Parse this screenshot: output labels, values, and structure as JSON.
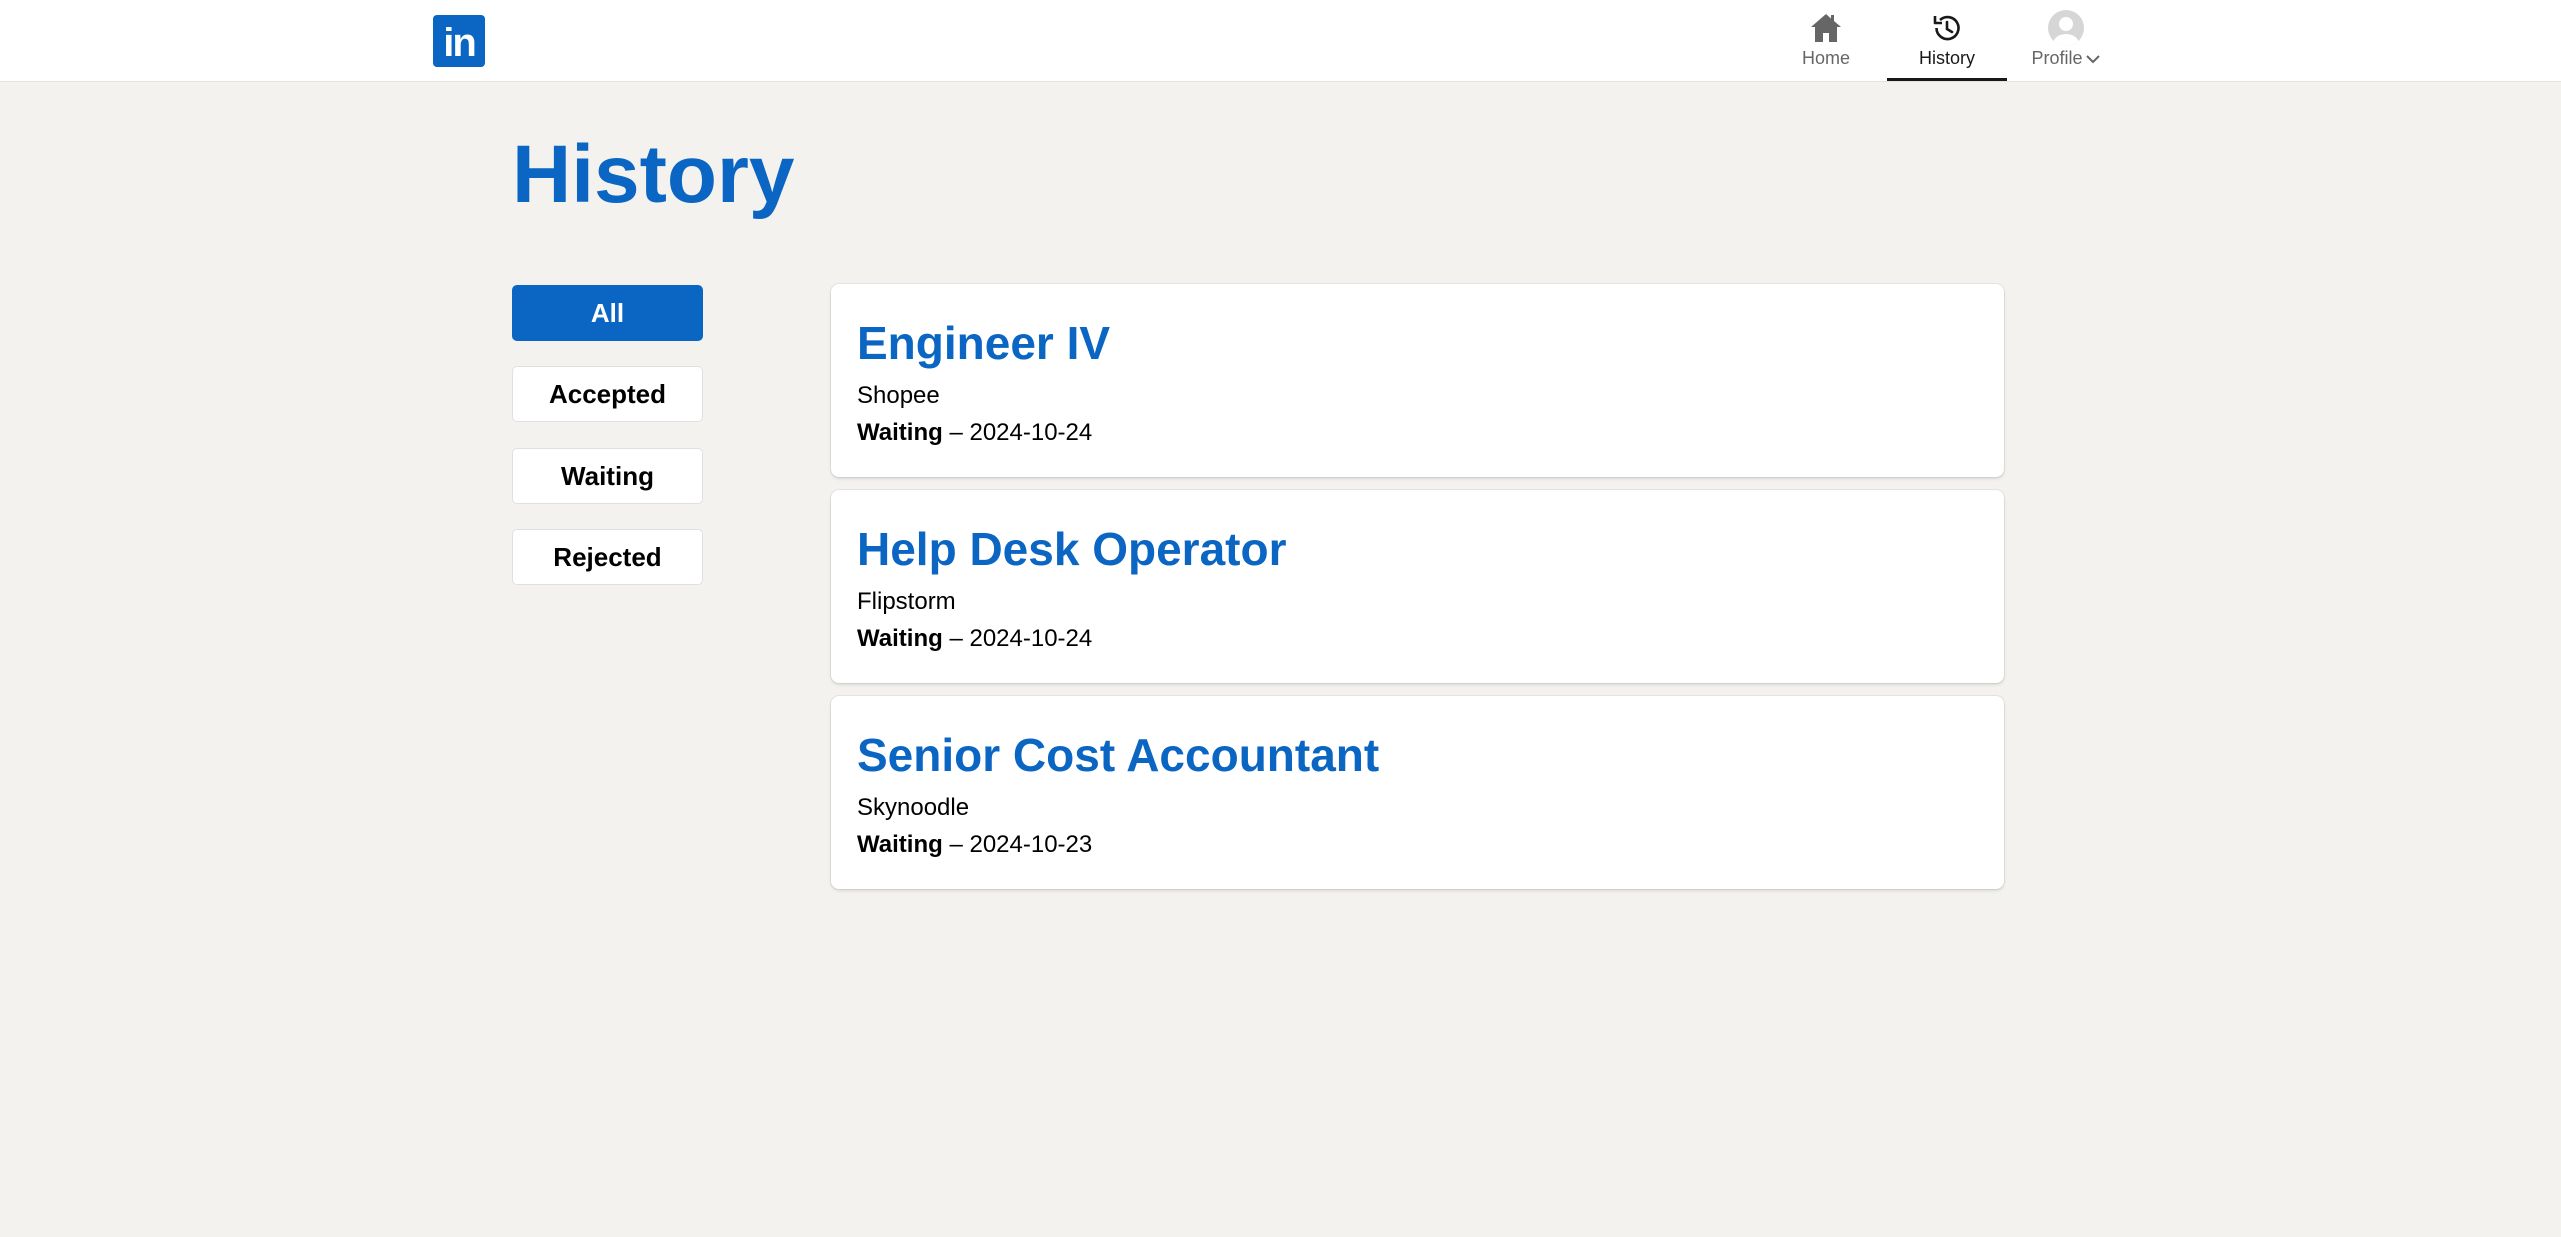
{
  "header": {
    "logo_text": "in",
    "nav": [
      {
        "label": "Home",
        "icon": "home-icon"
      },
      {
        "label": "History",
        "icon": "history-icon"
      },
      {
        "label": "Profile",
        "icon": "avatar"
      }
    ]
  },
  "page": {
    "title": "History"
  },
  "filters": [
    "All",
    "Accepted",
    "Waiting",
    "Rejected"
  ],
  "applications": [
    {
      "title": "Engineer IV",
      "company": "Shopee",
      "status": "Waiting",
      "separator": "–",
      "date": "2024-10-24"
    },
    {
      "title": "Help Desk Operator",
      "company": "Flipstorm",
      "status": "Waiting",
      "separator": "–",
      "date": "2024-10-24"
    },
    {
      "title": "Senior Cost Accountant",
      "company": "Skynoodle",
      "status": "Waiting",
      "separator": "–",
      "date": "2024-10-23"
    }
  ],
  "colors": {
    "brand": "#0a66c2",
    "background": "#f3f2ef"
  }
}
